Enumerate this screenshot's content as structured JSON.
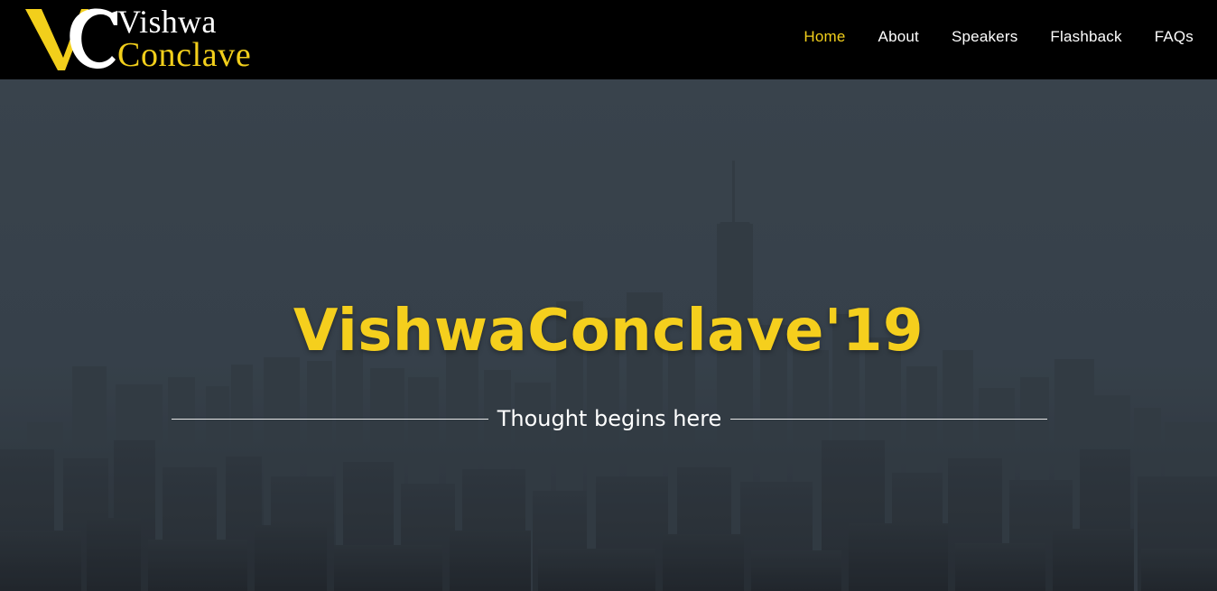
{
  "brand": {
    "word1": "Vishwa",
    "word2": "Conclave",
    "logo_icon": "vc-monogram-logo",
    "colors": {
      "accent": "#f2cf1b",
      "white": "#ffffff"
    }
  },
  "nav": {
    "items": [
      {
        "label": "Home",
        "active": true
      },
      {
        "label": "About",
        "active": false
      },
      {
        "label": "Speakers",
        "active": false
      },
      {
        "label": "Flashback",
        "active": false
      },
      {
        "label": "FAQs",
        "active": false
      }
    ]
  },
  "hero": {
    "title": "VishwaConclave'19",
    "tagline": "Thought begins here",
    "background": "city-skyline-image",
    "colors": {
      "title": "#f5cf1d",
      "overlay": "#39434c"
    }
  }
}
